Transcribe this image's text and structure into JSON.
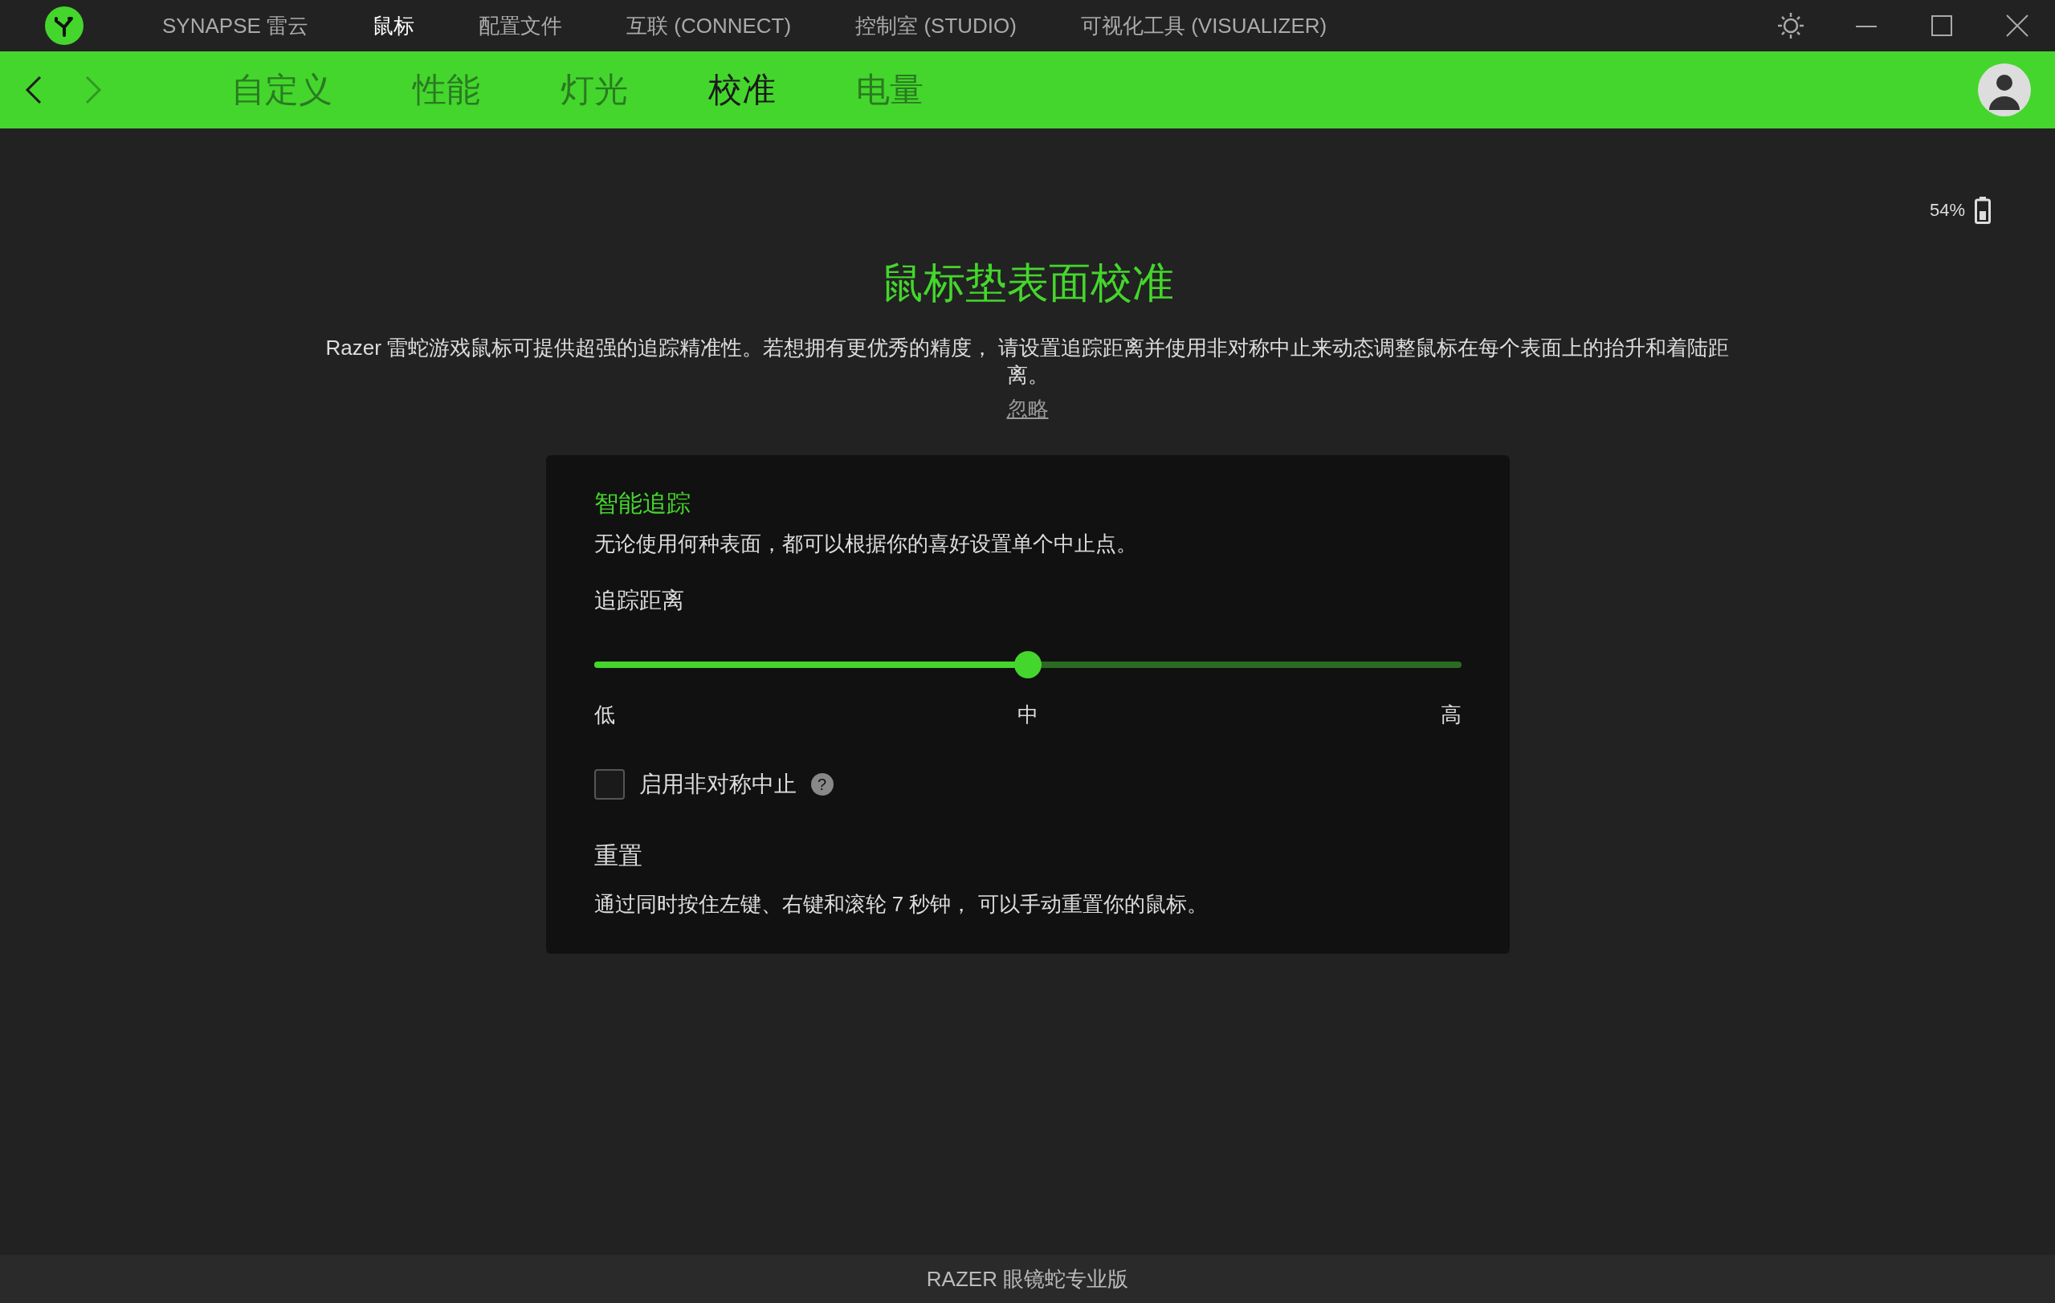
{
  "top_menu": [
    {
      "label": "SYNAPSE 雷云",
      "selected": false
    },
    {
      "label": "鼠标",
      "selected": true
    },
    {
      "label": "配置文件",
      "selected": false
    },
    {
      "label": "互联 (CONNECT)",
      "selected": false
    },
    {
      "label": "控制室 (STUDIO)",
      "selected": false
    },
    {
      "label": "可视化工具 (VISUALIZER)",
      "selected": false
    }
  ],
  "nav": {
    "back_disabled": false,
    "forward_disabled": true
  },
  "sub_tabs": [
    {
      "label": "自定义",
      "selected": false
    },
    {
      "label": "性能",
      "selected": false
    },
    {
      "label": "灯光",
      "selected": false
    },
    {
      "label": "校准",
      "selected": true
    },
    {
      "label": "电量",
      "selected": false
    }
  ],
  "battery": {
    "reading": "54%"
  },
  "heading": "鼠标垫表面校准",
  "description": "Razer 雷蛇游戏鼠标可提供超强的追踪精准性。若想拥有更优秀的精度， 请设置追踪距离并使用非对称中止来动态调整鼠标在每个表面上的抬升和着陆距离。",
  "dismiss_link": "忽略",
  "panel": {
    "title": "智能追踪",
    "subtitle": "无论使用何种表面，都可以根据你的喜好设置单个中止点。",
    "slider": {
      "label": "追踪距离",
      "level": 0.5,
      "ticks": [
        "低",
        "中",
        "高"
      ]
    },
    "checkbox": {
      "label": "启用非对称中止",
      "checked": false,
      "help": "?"
    },
    "reset": {
      "title": "重置",
      "text": "通过同时按住左键、右键和滚轮 7 秒钟， 可以手动重置你的鼠标。"
    }
  },
  "footer": "RAZER 眼镜蛇专业版"
}
